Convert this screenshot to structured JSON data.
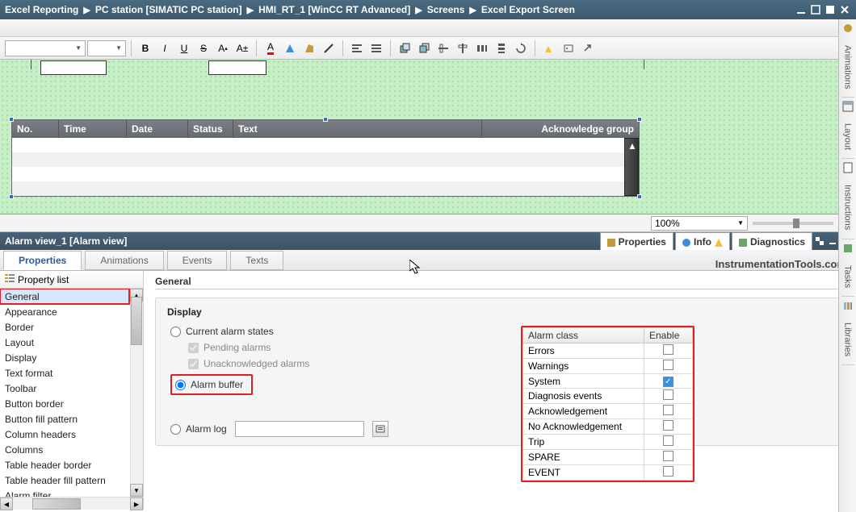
{
  "title": {
    "crumbs": [
      "Excel Reporting",
      "PC station [SIMATIC PC station]",
      "HMI_RT_1 [WinCC RT Advanced]",
      "Screens",
      "Excel Export Screen"
    ]
  },
  "fmt": {
    "font_combo": "",
    "size_combo": ""
  },
  "alarm_view": {
    "cols": [
      "No.",
      "Time",
      "Date",
      "Status",
      "Text",
      "Acknowledge group"
    ]
  },
  "zoom": {
    "value": "100%"
  },
  "prop_title": "Alarm view_1 [Alarm view]",
  "right_tabs": {
    "properties": "Properties",
    "info": "Info",
    "diagnostics": "Diagnostics"
  },
  "tabs": {
    "properties": "Properties",
    "animations": "Animations",
    "events": "Events",
    "texts": "Texts"
  },
  "watermark": "InstrumentationTools.com",
  "proplist": {
    "title": "Property list",
    "items": [
      "General",
      "Appearance",
      "Border",
      "Layout",
      "Display",
      "Text format",
      "Toolbar",
      "Button border",
      "Button fill pattern",
      "Column headers",
      "Columns",
      "Table header border",
      "Table header fill pattern",
      "Alarm filter"
    ],
    "selected": "General"
  },
  "general": {
    "section": "General",
    "display_title": "Display",
    "opt_current": "Current alarm states",
    "opt_pending": "Pending alarms",
    "opt_unack": "Unacknowledged alarms",
    "opt_buffer": "Alarm buffer",
    "opt_log": "Alarm log",
    "table": {
      "h1": "Alarm class",
      "h2": "Enable",
      "rows": [
        {
          "name": "Errors",
          "enable": false
        },
        {
          "name": "Warnings",
          "enable": false
        },
        {
          "name": "System",
          "enable": true
        },
        {
          "name": "Diagnosis events",
          "enable": false
        },
        {
          "name": "Acknowledgement",
          "enable": false
        },
        {
          "name": "No Acknowledgement",
          "enable": false
        },
        {
          "name": "Trip",
          "enable": false
        },
        {
          "name": "SPARE",
          "enable": false
        },
        {
          "name": "EVENT",
          "enable": false
        }
      ]
    }
  },
  "vtabs": [
    "Animations",
    "Layout",
    "Instructions",
    "Tasks",
    "Libraries"
  ]
}
